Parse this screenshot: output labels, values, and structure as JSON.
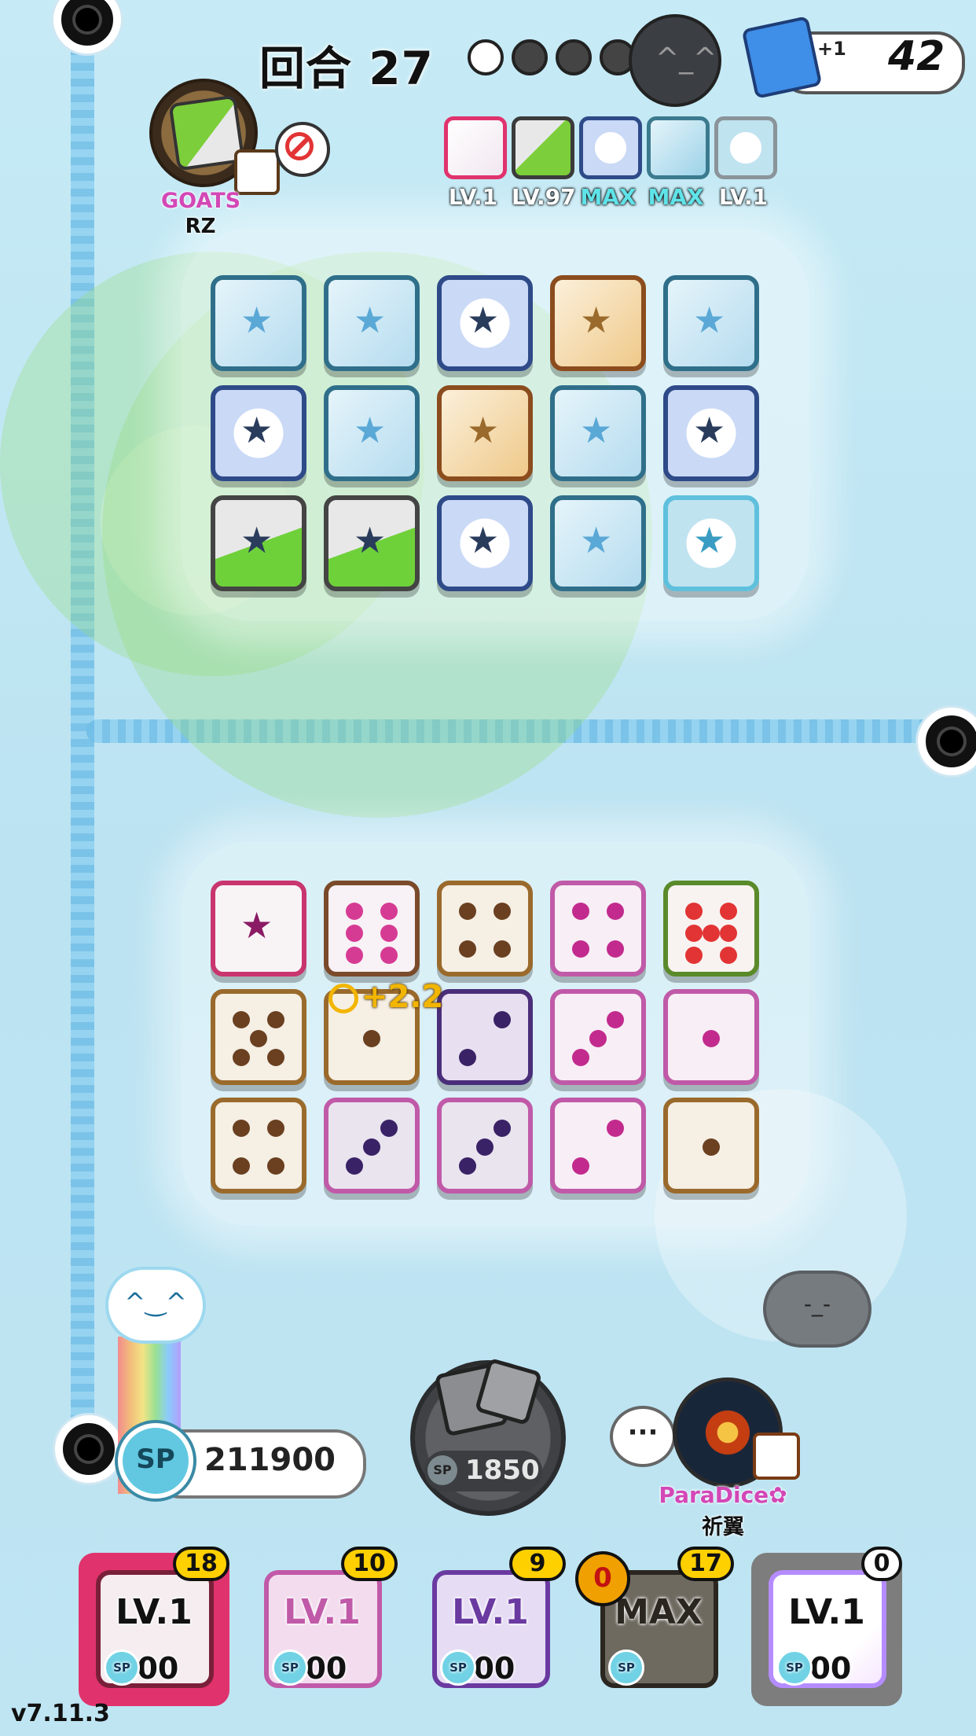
{
  "hud": {
    "round_label": "回合 27",
    "wave_dots": [
      "filled",
      "empty",
      "empty",
      "empty"
    ],
    "deck_plus": "+1",
    "deck_count": "42"
  },
  "opponent": {
    "name": "GOATS",
    "tag": "RZ",
    "loadout": [
      {
        "label": "LV.1",
        "color": "#ffffff",
        "border": "#e0336d"
      },
      {
        "label": "LV.97",
        "color": "#ffffff",
        "border": "#3b3b3b"
      },
      {
        "label": "MAX",
        "color": "#5fe3e8",
        "border": "#3b3b3b"
      },
      {
        "label": "MAX",
        "color": "#5fe3e8",
        "border": "#3b3b3b"
      },
      {
        "label": "LV.1",
        "color": "#ffffff",
        "border": "#8a9499"
      }
    ]
  },
  "field_buff": "+2.2",
  "player": {
    "sp": "211900",
    "sp_label": "SP",
    "roll_cost": "1850",
    "chat_label": "···",
    "name": "ParaDice✿",
    "tag": "祈翼"
  },
  "deck": [
    {
      "level": "LV.1",
      "cost": "100",
      "count": "18",
      "border": "#e0336d",
      "tint": "#f5edf0"
    },
    {
      "level": "LV.1",
      "cost": "100",
      "count": "10",
      "border": "#c05aa8",
      "tint": "#f2dcee"
    },
    {
      "level": "LV.1",
      "cost": "100",
      "count": "9",
      "border": "#6a3aa0",
      "tint": "#e6dcf4"
    },
    {
      "level": "MAX",
      "cost": "0",
      "count": "17",
      "badge": "0",
      "border": "#2b2620",
      "tint": "#6f6a60"
    },
    {
      "level": "LV.1",
      "cost": "100",
      "count": "0",
      "border": "#8d8d8d",
      "tint": "#ffffff"
    }
  ],
  "version": "v7.11.3"
}
